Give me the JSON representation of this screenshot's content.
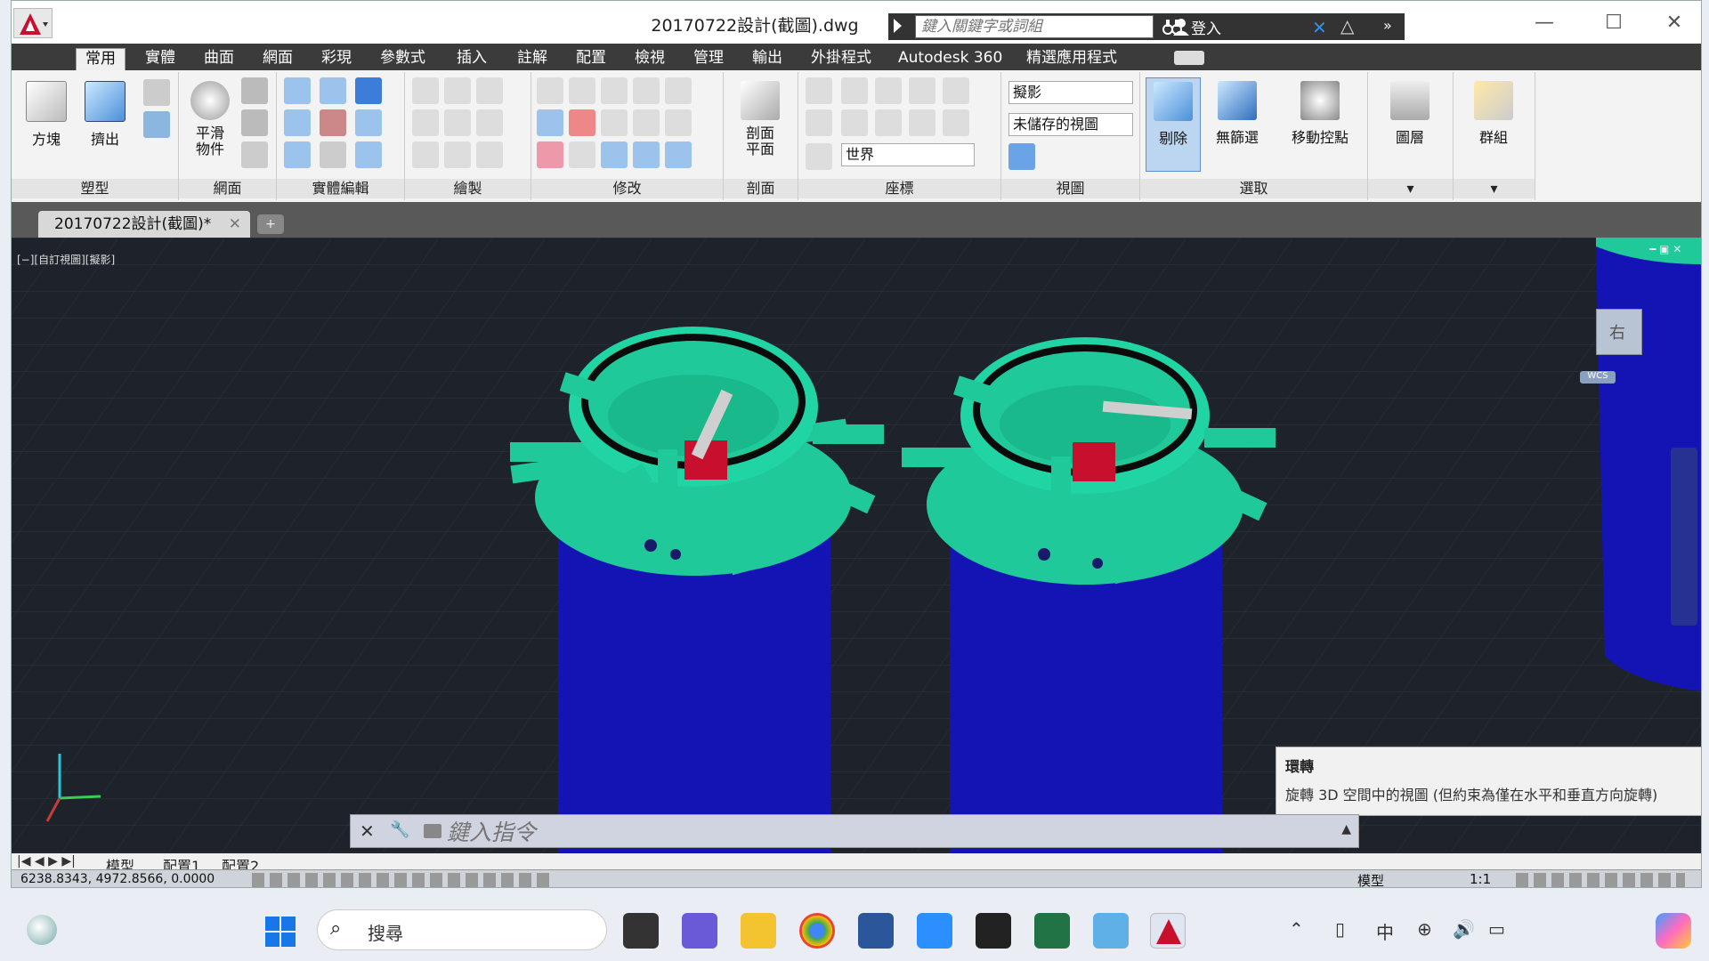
{
  "titlebar": {
    "document_title": "20170722設計(截圖).dwg",
    "search_placeholder": "鍵入關鍵字或詞組",
    "signin_label": "登入"
  },
  "ribbon_tabs": [
    {
      "label": "常用",
      "active": true
    },
    {
      "label": "實體"
    },
    {
      "label": "曲面"
    },
    {
      "label": "網面"
    },
    {
      "label": "彩現"
    },
    {
      "label": "參數式"
    },
    {
      "label": "插入"
    },
    {
      "label": "註解"
    },
    {
      "label": "配置"
    },
    {
      "label": "檢視"
    },
    {
      "label": "管理"
    },
    {
      "label": "輸出"
    },
    {
      "label": "外掛程式"
    },
    {
      "label": "Autodesk 360"
    },
    {
      "label": "精選應用程式"
    }
  ],
  "panels": {
    "modeling": {
      "title": "塑型",
      "box_label": "方塊",
      "extrude_label": "擠出"
    },
    "mesh": {
      "title": "網面",
      "smooth_label": "平滑\n物件"
    },
    "solid_edit": {
      "title": "實體編輯"
    },
    "draw": {
      "title": "繪製"
    },
    "modify": {
      "title": "修改"
    },
    "section": {
      "title": "剖面",
      "plane_label": "剖面\n平面"
    },
    "coordinates": {
      "title": "座標",
      "ucs_value": "世界"
    },
    "view": {
      "title": "視圖",
      "visual_style": "擬影",
      "saved_view": "未儲存的視圖"
    },
    "selection": {
      "title": "選取",
      "cull_label": "剔除",
      "nofilter_label": "無篩選",
      "gizmo_label": "移動控點"
    },
    "layers": {
      "title": "圖層"
    },
    "groups": {
      "title": "群組"
    }
  },
  "doc_tab": {
    "label": "20170722設計(截圖)*"
  },
  "viewport": {
    "label": "[−][自訂視圖][擬影]",
    "viewcube_face": "右",
    "viewcube_ucs": "WCS"
  },
  "tooltip": {
    "title": "環轉",
    "body": "旋轉 3D 空間中的視圖 (但約束為僅在水平和垂直方向旋轉)"
  },
  "command_line": {
    "placeholder": "鍵入指令"
  },
  "layout_tabs": [
    {
      "label": "模型",
      "active": true
    },
    {
      "label": "配置1"
    },
    {
      "label": "配置2"
    }
  ],
  "statusbar": {
    "coordinates": "6238.8343, 4972.8566, 0.0000",
    "model_label": "模型",
    "scale": "1:1"
  },
  "taskbar": {
    "search_label": "搜尋",
    "ime_label": "中"
  },
  "colors": {
    "titlebar_dark": "#3b3b3b",
    "viewport_bg": "#1e232b",
    "tank_green": "#1fc99a",
    "tank_blue": "#1414b4",
    "accent_red": "#c8102e"
  }
}
